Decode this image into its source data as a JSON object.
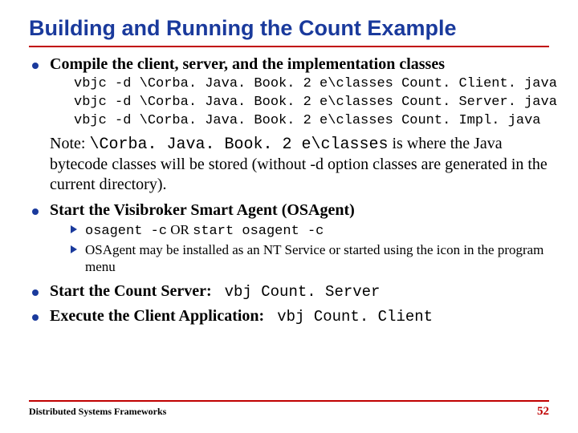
{
  "title": "Building and Running the Count Example",
  "b1": {
    "head": "Compile the client, server, and the implementation classes",
    "code": "vbjc -d \\Corba. Java. Book. 2 e\\classes Count. Client. java\nvbjc -d \\Corba. Java. Book. 2 e\\classes Count. Server. java\nvbjc -d \\Corba. Java. Book. 2 e\\classes Count. Impl. java",
    "note_pre": "Note: ",
    "note_mono": "\\Corba. Java. Book. 2 e\\classes",
    "note_post": " is where the Java bytecode classes will be stored (without -d option classes are generated in the current directory)."
  },
  "b2": {
    "head": "Start the Visibroker Smart Agent (OSAgent)",
    "sub1_a": "osagent -c",
    "sub1_or": "   OR   ",
    "sub1_b": "start osagent -c",
    "sub2": "OSAgent may be installed as an NT Service or started using the icon in the program menu"
  },
  "b3": {
    "head": "Start the Count Server:",
    "cmd": "vbj Count. Server"
  },
  "b4": {
    "head": "Execute the Client Application:",
    "cmd": "vbj Count. Client"
  },
  "footer": {
    "left": "Distributed Systems Frameworks",
    "page": "52"
  }
}
